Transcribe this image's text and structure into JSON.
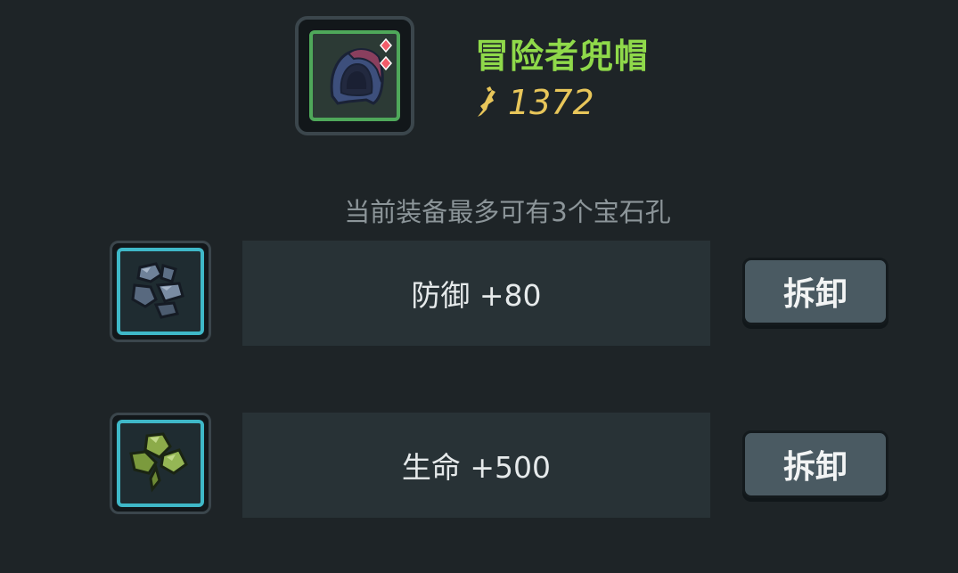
{
  "item": {
    "name": "冒险者兜帽",
    "power": "1372",
    "icon": "hood-icon",
    "colors": {
      "name": "#8fd94a",
      "power": "#e8c65a",
      "frame_border": "#4fa85a"
    }
  },
  "hint": "当前装备最多可有3个宝石孔",
  "gems": [
    {
      "icon": "gray-gem-icon",
      "stat": "防御 +80",
      "button_label": "拆卸"
    },
    {
      "icon": "green-gem-icon",
      "stat": "生命 +500",
      "button_label": "拆卸"
    }
  ]
}
